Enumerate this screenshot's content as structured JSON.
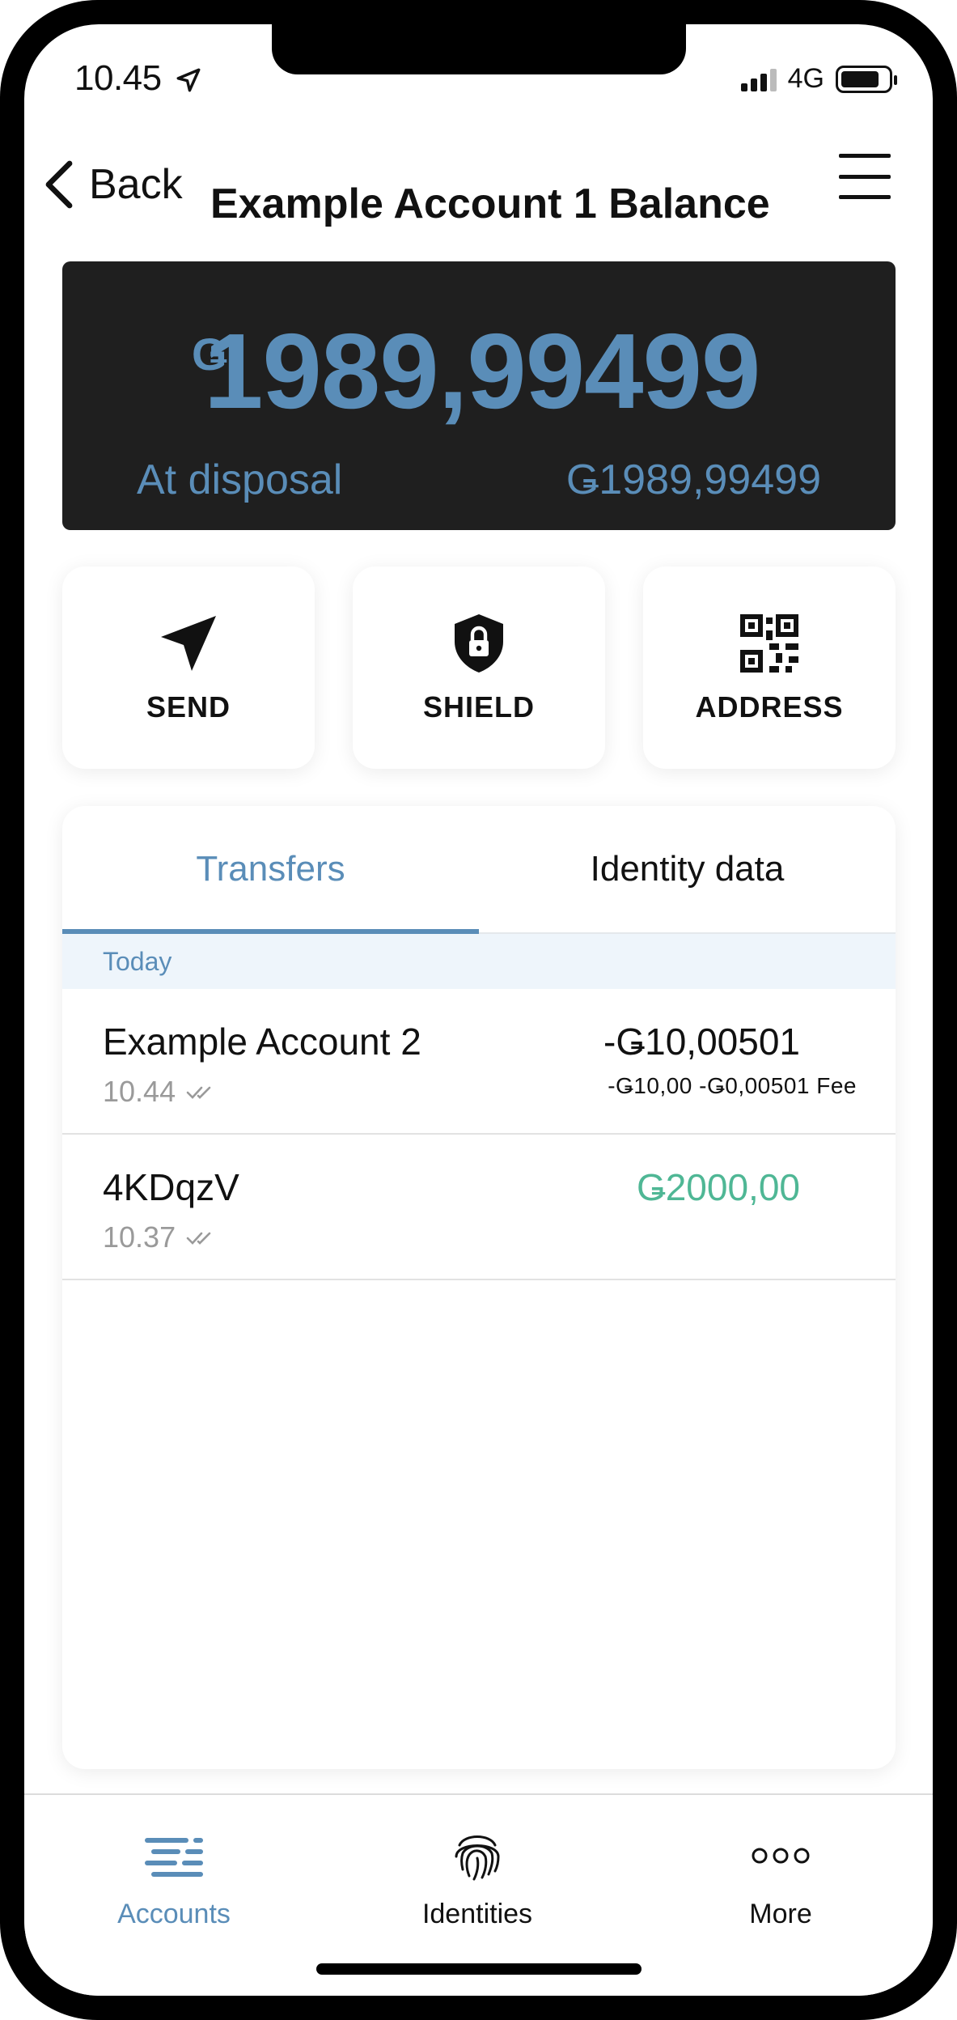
{
  "status_bar": {
    "time": "10.45",
    "network": "4G"
  },
  "header": {
    "back_label": "Back",
    "title": "Example Account 1 Balance"
  },
  "balance": {
    "currency_symbol": "Ǥ",
    "amount": "1989,99499",
    "disposal_label": "At disposal",
    "disposal_value": "Ǥ1989,99499"
  },
  "actions": {
    "send": "SEND",
    "shield": "SHIELD",
    "address": "ADDRESS"
  },
  "tabs": {
    "transfers": "Transfers",
    "identity_data": "Identity data"
  },
  "section": {
    "today": "Today"
  },
  "transactions": [
    {
      "name": "Example Account 2",
      "time": "10.44",
      "amount": "-Ǥ10,00501",
      "sub": "-Ǥ10,00 -Ǥ0,00501 Fee"
    },
    {
      "name": "4KDqzV",
      "time": "10.37",
      "amount": "Ǥ2000,00",
      "sub": ""
    }
  ],
  "nav": {
    "accounts": "Accounts",
    "identities": "Identities",
    "more": "More"
  },
  "colors": {
    "accent": "#5a8db8",
    "positive": "#4fb795",
    "card_bg": "#1f1f1f",
    "section_bg": "#eef5fb"
  },
  "icons": {
    "location": "location-arrow-icon",
    "back": "chevron-left-icon",
    "menu": "hamburger-menu-icon",
    "send": "paper-plane-icon",
    "shield": "shield-lock-icon",
    "address": "qr-code-icon",
    "status": "double-check-icon",
    "accounts": "list-lines-icon",
    "identities": "fingerprint-icon",
    "more": "three-dots-icon"
  }
}
